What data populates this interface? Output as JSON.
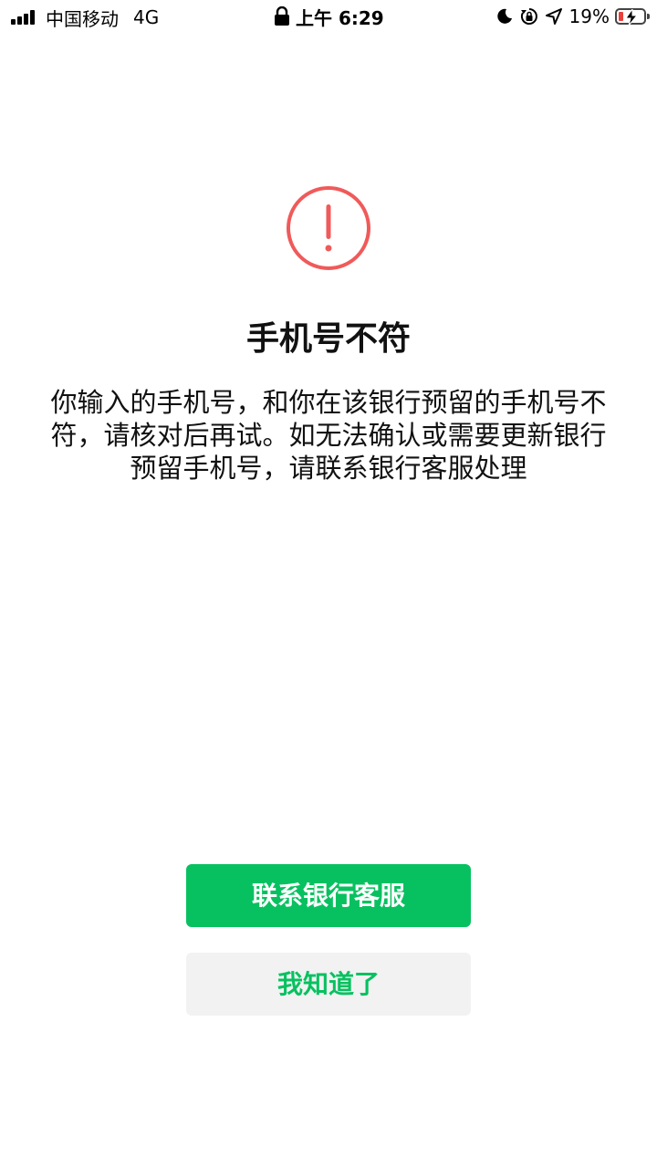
{
  "status_bar": {
    "carrier": "中国移动",
    "network": "4G",
    "time": "上午 6:29",
    "battery_percent": "19%",
    "icons": [
      "signal-icon",
      "lock-icon",
      "moon-icon",
      "rotation-lock-icon",
      "location-arrow-icon",
      "battery-icon"
    ]
  },
  "alert": {
    "icon": "exclamation-circle-icon",
    "icon_color": "#f05a5a",
    "title": "手机号不符",
    "message_lines": [
      "你输入的手机号，和你在该银行预留的手机号不",
      "符，请核对后再试。如无法确认或需要更新银行",
      "预留手机号，请联系银行客服处理"
    ]
  },
  "buttons": {
    "primary_label": "联系银行客服",
    "secondary_label": "我知道了",
    "accent_color": "#07c160"
  }
}
